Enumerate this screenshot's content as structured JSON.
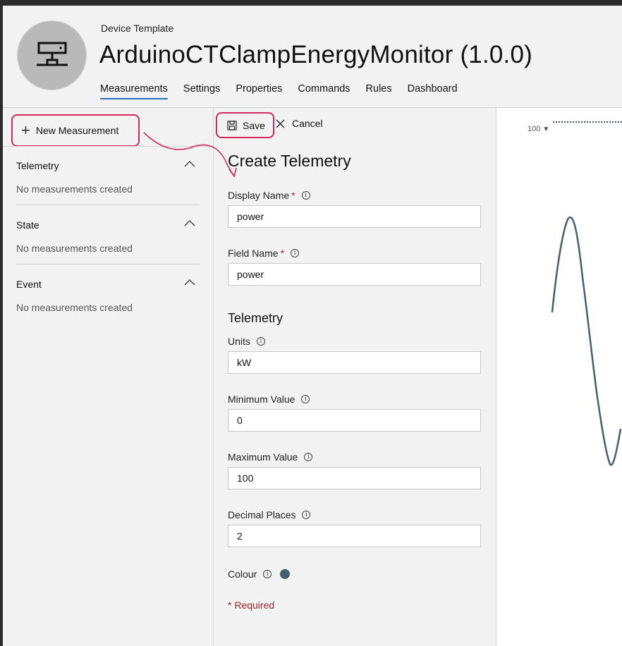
{
  "header": {
    "breadcrumb": "Device Template",
    "title": "ArduinoCTClampEnergyMonitor",
    "version": "(1.0.0)",
    "tabs": [
      {
        "label": "Measurements",
        "active": true
      },
      {
        "label": "Settings",
        "active": false
      },
      {
        "label": "Properties",
        "active": false
      },
      {
        "label": "Commands",
        "active": false
      },
      {
        "label": "Rules",
        "active": false
      },
      {
        "label": "Dashboard",
        "active": false
      }
    ],
    "icon": "device-network-icon"
  },
  "left_panel": {
    "new_measurement_label": "New Measurement",
    "sections": [
      {
        "title": "Telemetry",
        "empty_text": "No measurements created"
      },
      {
        "title": "State",
        "empty_text": "No measurements created"
      },
      {
        "title": "Event",
        "empty_text": "No measurements created"
      }
    ]
  },
  "form": {
    "save_label": "Save",
    "cancel_label": "Cancel",
    "title": "Create Telemetry",
    "display_name": {
      "label": "Display Name",
      "required_mark": "*",
      "value": "power"
    },
    "field_name": {
      "label": "Field Name",
      "required_mark": "*",
      "value": "power"
    },
    "section_title": "Telemetry",
    "units": {
      "label": "Units",
      "value": "kW"
    },
    "minimum_value": {
      "label": "Minimum Value",
      "value": "0"
    },
    "maximum_value": {
      "label": "Maximum Value",
      "value": "100"
    },
    "decimal_places": {
      "label": "Decimal Places",
      "value": "2"
    },
    "colour": {
      "label": "Colour",
      "value": "#44606e"
    },
    "required_note": "* Required"
  },
  "preview": {
    "scale_max_label": "100",
    "line_color": "#44606e"
  },
  "colors": {
    "accent_tab": "#2a6ebb",
    "annotation": "#d02a5e",
    "required": "#a4262c"
  }
}
